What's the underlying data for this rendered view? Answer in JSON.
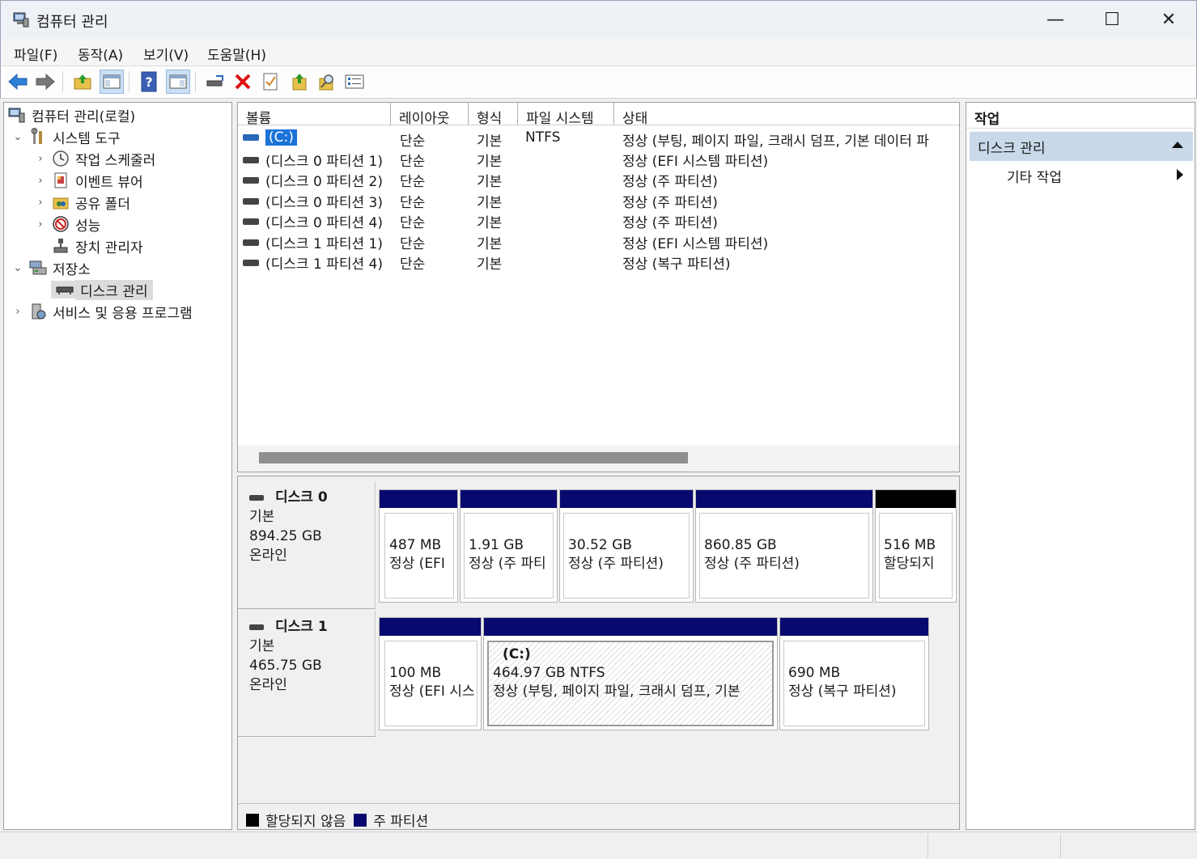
{
  "window": {
    "title": "컴퓨터 관리",
    "minimize": "—",
    "maximize": "☐",
    "close": "✕"
  },
  "menu": [
    "파일(F)",
    "동작(A)",
    "보기(V)",
    "도움말(H)"
  ],
  "tree": {
    "root": "컴퓨터 관리(로컬)",
    "system_tools": "시스템 도구",
    "task_scheduler": "작업 스케줄러",
    "event_viewer": "이벤트 뷰어",
    "shared_folders": "공유 폴더",
    "performance": "성능",
    "device_manager": "장치 관리자",
    "storage": "저장소",
    "disk_management": "디스크 관리",
    "services_apps": "서비스 및 응용 프로그램"
  },
  "volume_list": {
    "columns": [
      "볼륨",
      "레이아웃",
      "형식",
      "파일 시스템",
      "상태"
    ],
    "rows": [
      {
        "volume": "(C:)",
        "layout": "단순",
        "type": "기본",
        "fs": "NTFS",
        "status": "정상 (부팅, 페이지 파일, 크래시 덤프, 기본 데이터 파"
      },
      {
        "volume": "(디스크 0 파티션 1)",
        "layout": "단순",
        "type": "기본",
        "fs": "",
        "status": "정상 (EFI 시스템 파티션)"
      },
      {
        "volume": "(디스크 0 파티션 2)",
        "layout": "단순",
        "type": "기본",
        "fs": "",
        "status": "정상 (주 파티션)"
      },
      {
        "volume": "(디스크 0 파티션 3)",
        "layout": "단순",
        "type": "기본",
        "fs": "",
        "status": "정상 (주 파티션)"
      },
      {
        "volume": "(디스크 0 파티션 4)",
        "layout": "단순",
        "type": "기본",
        "fs": "",
        "status": "정상 (주 파티션)"
      },
      {
        "volume": "(디스크 1 파티션 1)",
        "layout": "단순",
        "type": "기본",
        "fs": "",
        "status": "정상 (EFI 시스템 파티션)"
      },
      {
        "volume": "(디스크 1 파티션 4)",
        "layout": "단순",
        "type": "기본",
        "fs": "",
        "status": "정상 (복구 파티션)"
      }
    ]
  },
  "disks": [
    {
      "name": "디스크 0",
      "kind": "기본",
      "size": "894.25 GB",
      "state": "온라인",
      "partitions": [
        {
          "size": "487 MB",
          "status": "정상 (EFI"
        },
        {
          "size": "1.91 GB",
          "status": "정상 (주 파티"
        },
        {
          "size": "30.52 GB",
          "status": "정상 (주 파티션)"
        },
        {
          "size": "860.85 GB",
          "status": "정상 (주 파티션)"
        },
        {
          "size": "516 MB",
          "status": "할당되지"
        }
      ]
    },
    {
      "name": "디스크 1",
      "kind": "기본",
      "size": "465.75 GB",
      "state": "온라인",
      "partitions": [
        {
          "size": "100 MB",
          "status": "정상 (EFI 시스"
        },
        {
          "label": "(C:)",
          "size": "464.97 GB NTFS",
          "status": "정상 (부팅, 페이지 파일, 크래시 덤프, 기본"
        },
        {
          "size": "690 MB",
          "status": "정상 (복구 파티션)"
        }
      ]
    }
  ],
  "legend": {
    "unallocated": "할당되지 않음",
    "primary": "주 파티션"
  },
  "actions": {
    "header": "작업",
    "section": "디스크 관리",
    "more": "기타 작업"
  },
  "colors": {
    "primary_partition": "#08086e",
    "unallocated": "#000000",
    "selection": "#1a73d8",
    "action_section": "#c9d9ea"
  }
}
